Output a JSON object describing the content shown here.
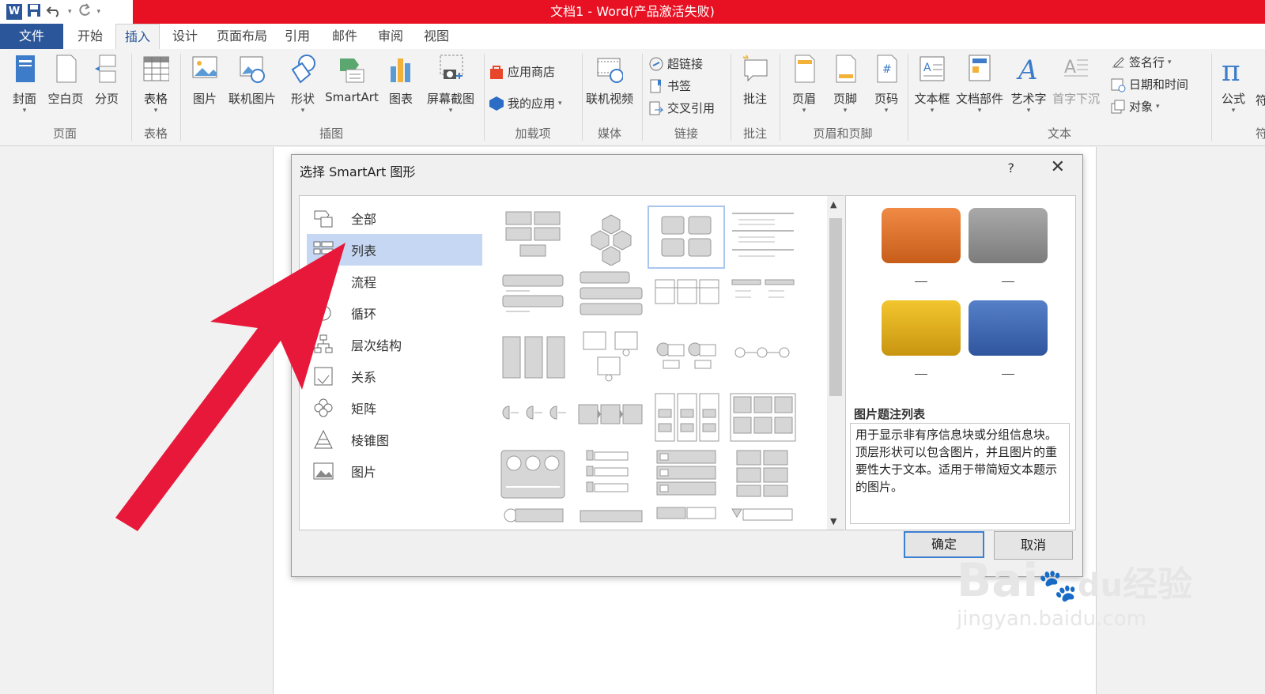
{
  "window": {
    "title": "文档1 -  Word(产品激活失败)"
  },
  "tabs": [
    "文件",
    "开始",
    "插入",
    "设计",
    "页面布局",
    "引用",
    "邮件",
    "审阅",
    "视图"
  ],
  "ribbon": {
    "page": {
      "buttons": [
        "封面",
        "空白页",
        "分页"
      ],
      "group": "页面"
    },
    "table": {
      "buttons": [
        "表格"
      ],
      "group": "表格"
    },
    "illustrations": {
      "buttons": [
        "图片",
        "联机图片",
        "形状",
        "SmartArt",
        "图表",
        "屏幕截图"
      ],
      "group": "插图"
    },
    "addins": {
      "store": "应用商店",
      "myapps": "我的应用",
      "group": "加载项"
    },
    "media": {
      "buttons": [
        "联机视频"
      ],
      "group": "媒体"
    },
    "links": {
      "hyperlink": "超链接",
      "bookmark": "书签",
      "crossref": "交叉引用",
      "group": "链接"
    },
    "comments": {
      "buttons": [
        "批注"
      ],
      "group": "批注"
    },
    "headerfooter": {
      "buttons": [
        "页眉",
        "页脚",
        "页码"
      ],
      "group": "页眉和页脚"
    },
    "text": {
      "buttons": [
        "文本框",
        "文档部件",
        "艺术字",
        "首字下沉"
      ],
      "sigline": "签名行",
      "datetime": "日期和时间",
      "object": "对象",
      "group": "文本"
    },
    "symbols": {
      "buttons": [
        "公式"
      ],
      "partial": "符",
      "partial2": "符"
    }
  },
  "dialog": {
    "title": "选择 SmartArt 图形",
    "help": "?",
    "close": "✕",
    "categories": [
      "全部",
      "列表",
      "流程",
      "循环",
      "层次结构",
      "关系",
      "矩阵",
      "棱锥图",
      "图片"
    ],
    "selected_category": "列表",
    "preview": {
      "dash": "—",
      "title": "图片题注列表",
      "description": "用于显示非有序信息块或分组信息块。顶层形状可以包含图片，并且图片的重要性大于文本。适用于带简短文本题示的图片。",
      "colors": {
        "orange": "#e0702a",
        "gray": "#8f8f8f",
        "gold": "#e2b21e",
        "blue": "#3a66b2"
      }
    },
    "ok": "确定",
    "cancel": "取消"
  },
  "watermark": {
    "brand": "Bai",
    "du": "du",
    "cn": "经验",
    "url": "jingyan.baidu.com"
  },
  "colors": {
    "titlebar": "#e81123",
    "word_blue": "#2b579a",
    "arrow": "#e8183a",
    "selection": "#c5d7f2"
  }
}
